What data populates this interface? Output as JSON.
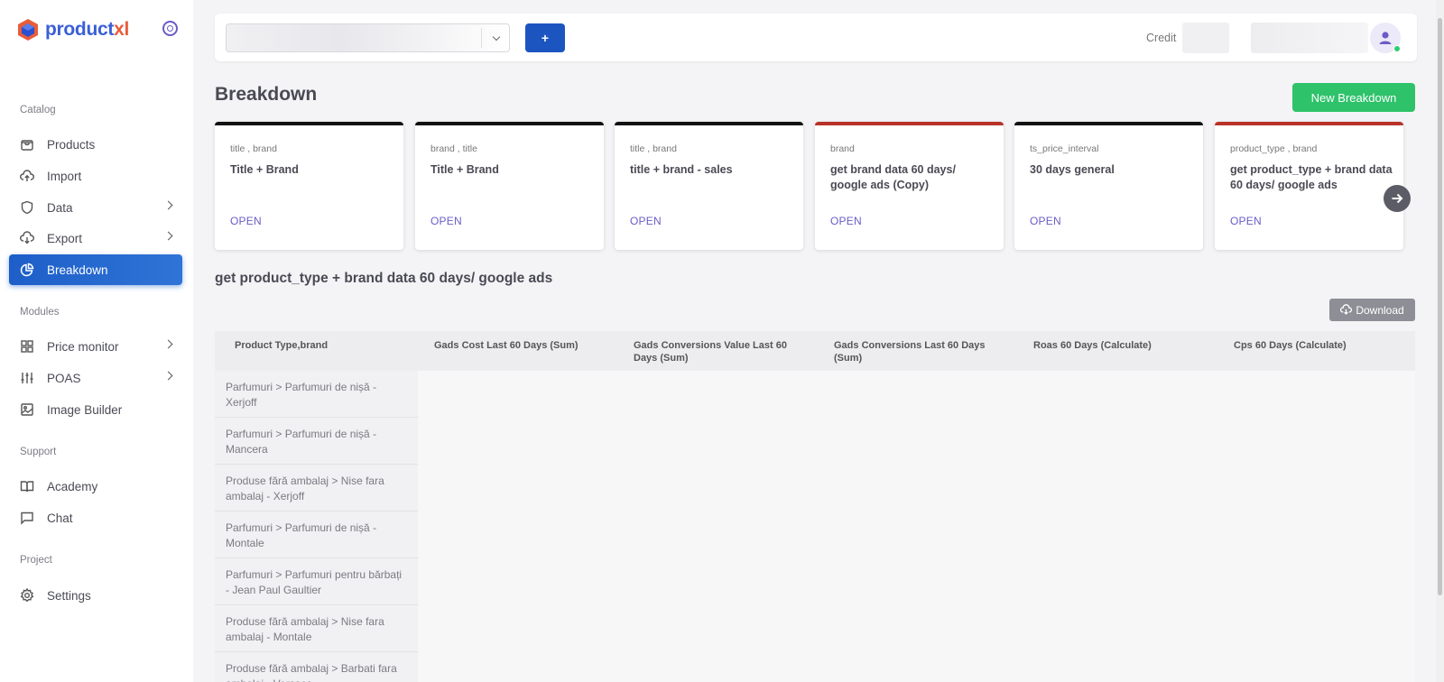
{
  "app": {
    "logo_main": "product",
    "logo_accent": "xl"
  },
  "sidebar": {
    "sections": {
      "catalog": "Catalog",
      "modules": "Modules",
      "support": "Support",
      "project": "Project"
    },
    "items": [
      {
        "label": "Products"
      },
      {
        "label": "Import"
      },
      {
        "label": "Data"
      },
      {
        "label": "Export"
      },
      {
        "label": "Breakdown"
      },
      {
        "label": "Price monitor"
      },
      {
        "label": "POAS"
      },
      {
        "label": "Image Builder"
      },
      {
        "label": "Academy"
      },
      {
        "label": "Chat"
      },
      {
        "label": "Settings"
      }
    ],
    "active": "Breakdown"
  },
  "topbar": {
    "add_label": "+",
    "credit_label": "Credit"
  },
  "page": {
    "title": "Breakdown",
    "new_button": "New Breakdown"
  },
  "cards": [
    {
      "fields": "title , brand",
      "name": "Title + Brand",
      "open": "OPEN",
      "accent": "#111111"
    },
    {
      "fields": "brand , title",
      "name": "Title + Brand",
      "open": "OPEN",
      "accent": "#111111"
    },
    {
      "fields": "title , brand",
      "name": "title + brand - sales",
      "open": "OPEN",
      "accent": "#111111"
    },
    {
      "fields": "brand",
      "name": "get brand data 60 days/ google ads (Copy)",
      "open": "OPEN",
      "accent": "#b83228"
    },
    {
      "fields": "ts_price_interval",
      "name": "30 days general",
      "open": "OPEN",
      "accent": "#111111"
    },
    {
      "fields": "product_type , brand",
      "name": "get product_type + brand data 60 days/ google ads",
      "open": "OPEN",
      "accent": "#b83228"
    }
  ],
  "report": {
    "title": "get product_type + brand data 60 days/ google ads",
    "download": "Download",
    "columns": [
      "Product Type,brand",
      "Gads Cost Last 60 Days (Sum)",
      "Gads Conversions Value Last 60 Days (Sum)",
      "Gads Conversions Last 60 Days (Sum)",
      "Roas 60 Days (Calculate)",
      "Cps 60 Days (Calculate)"
    ],
    "rows": [
      "Parfumuri > Parfumuri de nișă - Xerjoff",
      "Parfumuri > Parfumuri de nișă - Mancera",
      "Produse fără ambalaj > Nise fara ambalaj - Xerjoff",
      "Parfumuri > Parfumuri de nișă - Montale",
      "Parfumuri > Parfumuri pentru bărbați - Jean Paul Gaultier",
      "Produse fără ambalaj > Nise fara ambalaj - Montale",
      "Produse fără ambalaj > Barbati fara ambalaj - Versace"
    ]
  },
  "colors": {
    "primary": "#1c55c0",
    "success": "#2ec26a",
    "link": "#6a5cc8"
  }
}
